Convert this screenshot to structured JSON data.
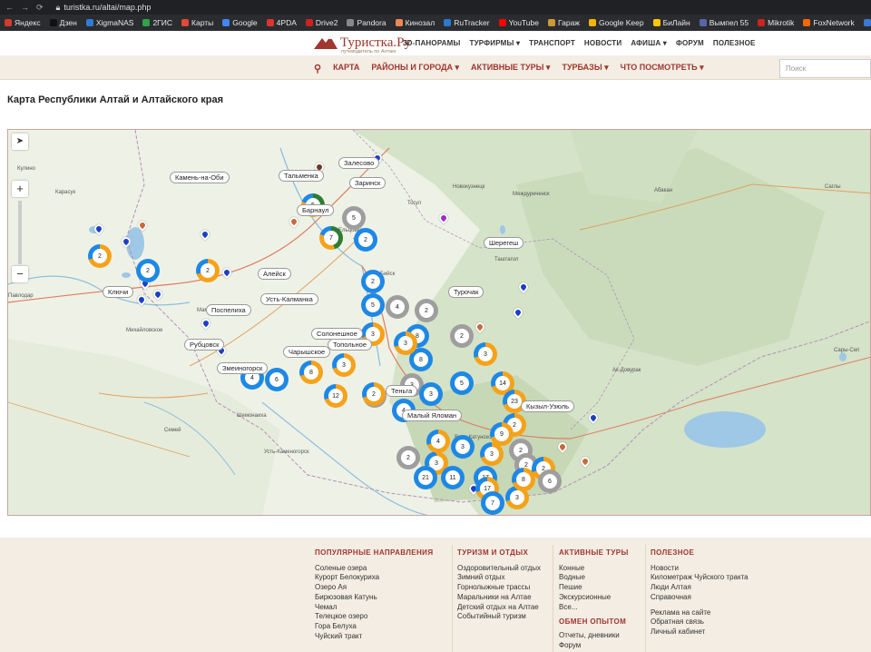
{
  "browser": {
    "url": "turistka.ru/altai/map.php",
    "bookmarks": [
      "Яндекс",
      "Дзен",
      "XigmaNAS",
      "2ГИС",
      "Карты",
      "Google",
      "4PDA",
      "Drive2",
      "Pandora",
      "Кинозал",
      "RuTracker",
      "YouTube",
      "Гараж",
      "Google Keep",
      "БиЛайн",
      "Вымпел 55",
      "Mikrotik",
      "FoxNetwork",
      "Удаленный рабоч...",
      "Полировка авто се..."
    ],
    "bookmark_colors": [
      "#d23b2e",
      "#111",
      "#2f7bd6",
      "#2ea34b",
      "#e04a36",
      "#4285f4",
      "#d33",
      "#c22",
      "#888",
      "#e85",
      "#2a7ad0",
      "#f00",
      "#c93",
      "#f6b400",
      "#ffc600",
      "#56a",
      "#c22",
      "#f60",
      "#3a7ad6",
      "#e53"
    ]
  },
  "site": {
    "logo_name": "Туристка.Ру",
    "logo_sub": "путеводитель по Алтаю",
    "top_menu": [
      "3D-ПАНОРАМЫ",
      "ТУРФИРМЫ ▾",
      "ТРАНСПОРТ",
      "НОВОСТИ",
      "АФИША ▾",
      "ФОРУМ",
      "ПОЛЕЗНОЕ"
    ],
    "main_nav": [
      "КАРТА",
      "РАЙОНЫ И ГОРОДА ▾",
      "АКТИВНЫЕ ТУРЫ ▾",
      "ТУРБАЗЫ ▾",
      "ЧТО ПОСМОТРЕТЬ ▾"
    ],
    "search_placeholder": "Поиск",
    "accent": "#a0362f"
  },
  "page": {
    "title": "Карта Республики Алтай и Алтайского края"
  },
  "map": {
    "controls": [
      "➤",
      "+",
      "−"
    ],
    "labels": [
      "Тальменка",
      "Залесово",
      "Заринск",
      "Камень-на-Оби",
      "Барнаул",
      "Шерегеш",
      "Алейск",
      "Ключи",
      "Усть-Калманка",
      "Поспелиха",
      "Турочак",
      "Солонешное",
      "Рубцовск",
      "Чарышское",
      "Топольное",
      "Змеиногорск",
      "Теньга",
      "Малый Яломан",
      "Кызыл-Узюль"
    ],
    "place_names": [
      "Кулино",
      "Карасук",
      "Павлодар",
      "Михайловское",
      "Семей",
      "Усть-Каменогорск",
      "Новокузнецк",
      "Междуреченск",
      "Абакан",
      "Таштагол",
      "Ак-Довурак",
      "Саглы",
      "Сары-Сеп",
      "Шемонаиха",
      "Троицкое",
      "Бийск",
      "Мамонтово",
      "Ельцовка",
      "Верх-Катунское",
      "Тогул"
    ],
    "clusters": [
      "2",
      "2",
      "2",
      "5",
      "7",
      "2",
      "2",
      "5",
      "4",
      "2",
      "3",
      "8",
      "2",
      "3",
      "4",
      "6",
      "8",
      "3",
      "2",
      "8",
      "3",
      "3",
      "12",
      "2",
      "4",
      "3",
      "14",
      "23",
      "2",
      "9",
      "5",
      "2",
      "3",
      "17",
      "2",
      "2",
      "3",
      "21",
      "11",
      "17",
      "7",
      "3",
      "8",
      "2",
      "6",
      "4",
      "3",
      "5"
    ]
  },
  "footer": {
    "col1": {
      "title": "ПОПУЛЯРНЫЕ НАПРАВЛЕНИЯ",
      "items": [
        "Соленые озера",
        "Курорт Белокуриха",
        "Озеро Ая",
        "Бирюзовая Катунь",
        "Чемал",
        "Телецкое озеро",
        "Гора Белуха",
        "Чуйский тракт"
      ]
    },
    "col2": {
      "title": "ТУРИЗМ И ОТДЫХ",
      "items": [
        "Оздоровительный отдых",
        "Зимний отдых",
        "Горнолыжные трассы",
        "Маральники на Алтае",
        "Детский отдых на Алтае",
        "Событийный туризм"
      ]
    },
    "col3": {
      "title": "АКТИВНЫЕ ТУРЫ",
      "items": [
        "Конные",
        "Водные",
        "Пешие",
        "Экскурсионные",
        "Все..."
      ],
      "sub_title": "ОБМЕН ОПЫТОМ",
      "sub_items": [
        "Отчеты, дневники",
        "Форум"
      ]
    },
    "col4": {
      "title": "ПОЛЕЗНОЕ",
      "items": [
        "Новости",
        "Километраж Чуйского тракта",
        "Люди Алтая",
        "Справочная"
      ],
      "items2": [
        "Реклама на сайте",
        "Обратная связь",
        "Личный кабинет"
      ]
    }
  }
}
